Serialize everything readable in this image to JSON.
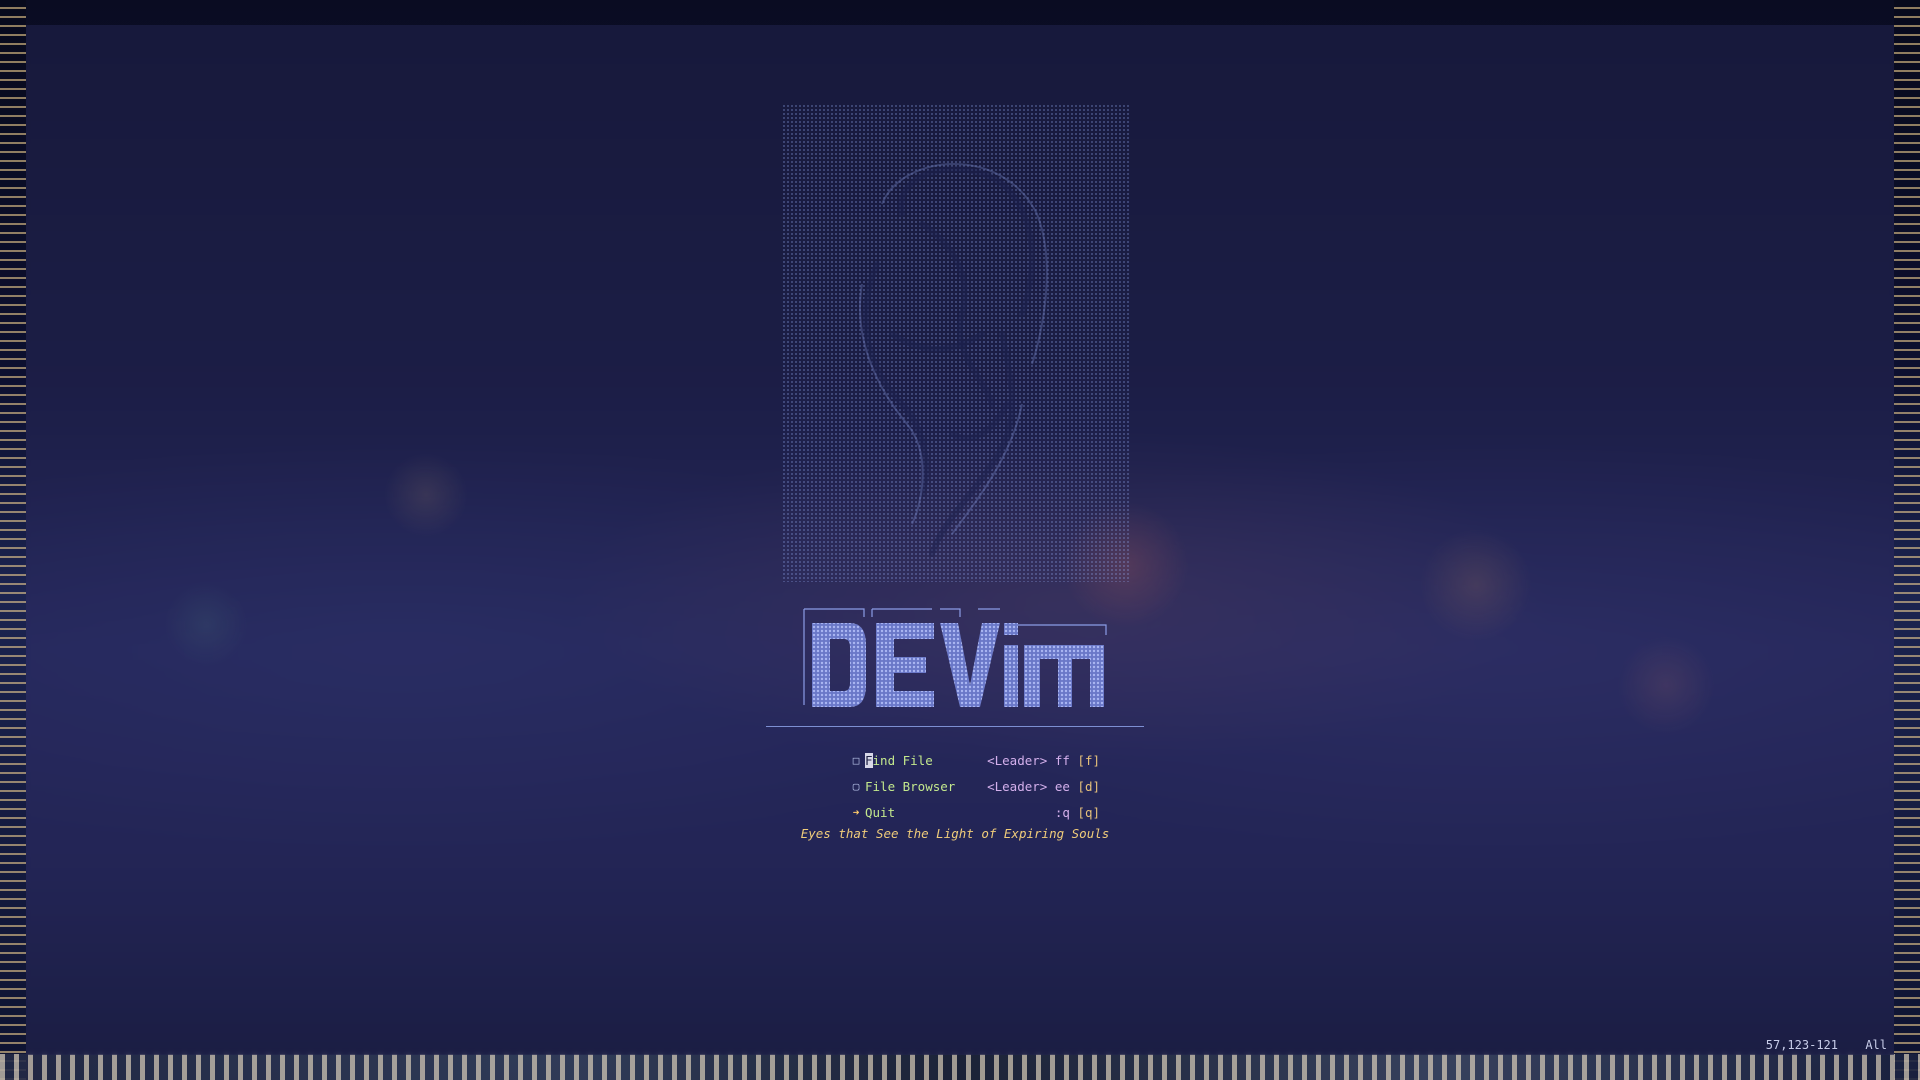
{
  "window": {
    "app": "DEVim"
  },
  "header": {
    "logo_text": "DEVim"
  },
  "menu": [
    {
      "icon": "file-icon",
      "label": "Find File",
      "keymap": "<Leader> ff",
      "key": "[f]"
    },
    {
      "icon": "folder-icon",
      "label": "File Browser",
      "keymap": "<Leader> ee",
      "key": "[d]"
    },
    {
      "icon": "bolt-icon",
      "label": "Quit",
      "keymap": ":q",
      "key": "[q]"
    }
  ],
  "tagline": "Eyes that See the Light of Expiring Souls",
  "statusline": {
    "position": "57,123-121",
    "scroll": "All"
  },
  "colors": {
    "label": "#c3e88d",
    "keymap": "#d4b0ec",
    "key": "#e5c07b",
    "tagline": "#f0cc7a",
    "logo": "#8b9ce6",
    "separator": "#7d8fd2"
  }
}
